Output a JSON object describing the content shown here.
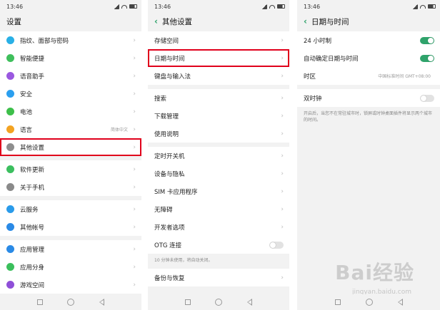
{
  "status": {
    "time": "13:46"
  },
  "screen1": {
    "title": "设置",
    "groups": [
      [
        {
          "label": "指纹、面部与密码",
          "icon": "fingerprint-icon",
          "color": "#29b0e6"
        },
        {
          "label": "智能便捷",
          "icon": "smart-icon",
          "color": "#3fbf5c"
        },
        {
          "label": "语音助手",
          "icon": "microphone-icon",
          "color": "#9a58e0"
        },
        {
          "label": "安全",
          "icon": "shield-icon",
          "color": "#2b9fef"
        },
        {
          "label": "电池",
          "icon": "battery-icon",
          "color": "#3dbf4a"
        },
        {
          "label": "语言",
          "value": "简体中文",
          "icon": "language-icon",
          "color": "#f3a322"
        },
        {
          "label": "其他设置",
          "icon": "gear-icon",
          "color": "#8e8e8e"
        }
      ],
      [
        {
          "label": "软件更新",
          "icon": "update-icon",
          "color": "#3cbf5f"
        },
        {
          "label": "关于手机",
          "icon": "info-icon",
          "color": "#8a8a8a"
        }
      ],
      [
        {
          "label": "云服务",
          "icon": "cloud-icon",
          "color": "#2a9bea"
        },
        {
          "label": "其他帐号",
          "icon": "account-icon",
          "color": "#2a8ae6"
        }
      ],
      [
        {
          "label": "应用管理",
          "icon": "apps-icon",
          "color": "#2a8ae6"
        },
        {
          "label": "应用分身",
          "icon": "clone-icon",
          "color": "#3bbf5c"
        },
        {
          "label": "游戏空间",
          "icon": "game-icon",
          "color": "#8f4fd8"
        }
      ]
    ]
  },
  "screen2": {
    "title": "其他设置",
    "groups": [
      [
        "存储空间",
        "日期与时间",
        "键盘与输入法"
      ],
      [
        "搜索",
        "下载管理",
        "使用说明"
      ],
      [
        "定时开关机",
        "设备与隐私",
        "SIM 卡应用程序",
        "无障碍",
        "开发者选项",
        "OTG 连接"
      ]
    ],
    "otg_hint": "10 分钟未使用，将自动关闭。",
    "last_item": "备份与恢复"
  },
  "screen3": {
    "title": "日期与时间",
    "items": {
      "hour24": "24 小时制",
      "auto": "自动确定日期与时间",
      "timezone": "时区",
      "timezone_value": "中国标准时间 GMT+08:00",
      "dual_clock": "双时钟"
    },
    "hint": "开启后，当您不在常驻城市时，锁屏或时钟桌面插件将显示两个城市的时间。",
    "watermark": "Bai经验",
    "watermark_sub": "jingyan.baidu.com"
  }
}
